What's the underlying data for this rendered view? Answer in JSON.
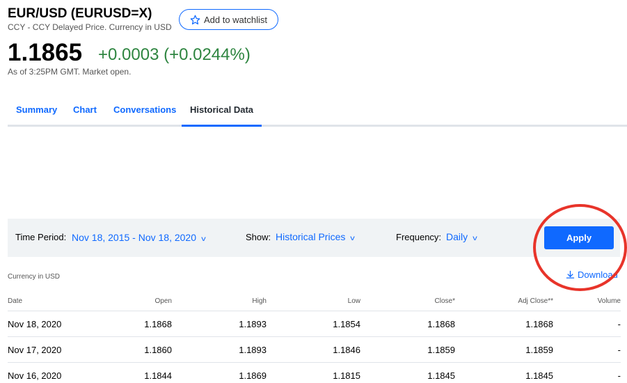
{
  "header": {
    "title": "EUR/USD (EURUSD=X)",
    "subtitle": "CCY - CCY Delayed Price. Currency in USD",
    "watchlist_label": "Add to watchlist",
    "price": "1.1865",
    "change": "+0.0003 (+0.0244%)",
    "as_of": "As of 3:25PM GMT. Market open."
  },
  "tabs": [
    {
      "label": "Summary"
    },
    {
      "label": "Chart"
    },
    {
      "label": "Conversations"
    },
    {
      "label": "Historical Data",
      "active": true
    }
  ],
  "filters": {
    "time_period_label": "Time Period:",
    "time_period_value": "Nov 18, 2015 - Nov 18, 2020",
    "show_label": "Show:",
    "show_value": "Historical Prices",
    "frequency_label": "Frequency:",
    "frequency_value": "Daily",
    "apply_label": "Apply"
  },
  "currency_note": "Currency in USD",
  "download_label": "Download",
  "table": {
    "headers": [
      "Date",
      "Open",
      "High",
      "Low",
      "Close*",
      "Adj Close**",
      "Volume"
    ],
    "rows": [
      [
        "Nov 18, 2020",
        "1.1868",
        "1.1893",
        "1.1854",
        "1.1868",
        "1.1868",
        "-"
      ],
      [
        "Nov 17, 2020",
        "1.1860",
        "1.1893",
        "1.1846",
        "1.1859",
        "1.1859",
        "-"
      ],
      [
        "Nov 16, 2020",
        "1.1844",
        "1.1869",
        "1.1815",
        "1.1845",
        "1.1845",
        "-"
      ]
    ]
  },
  "colors": {
    "accent": "#0f69ff",
    "positive": "#2e8540",
    "annotation": "#e8342a"
  }
}
